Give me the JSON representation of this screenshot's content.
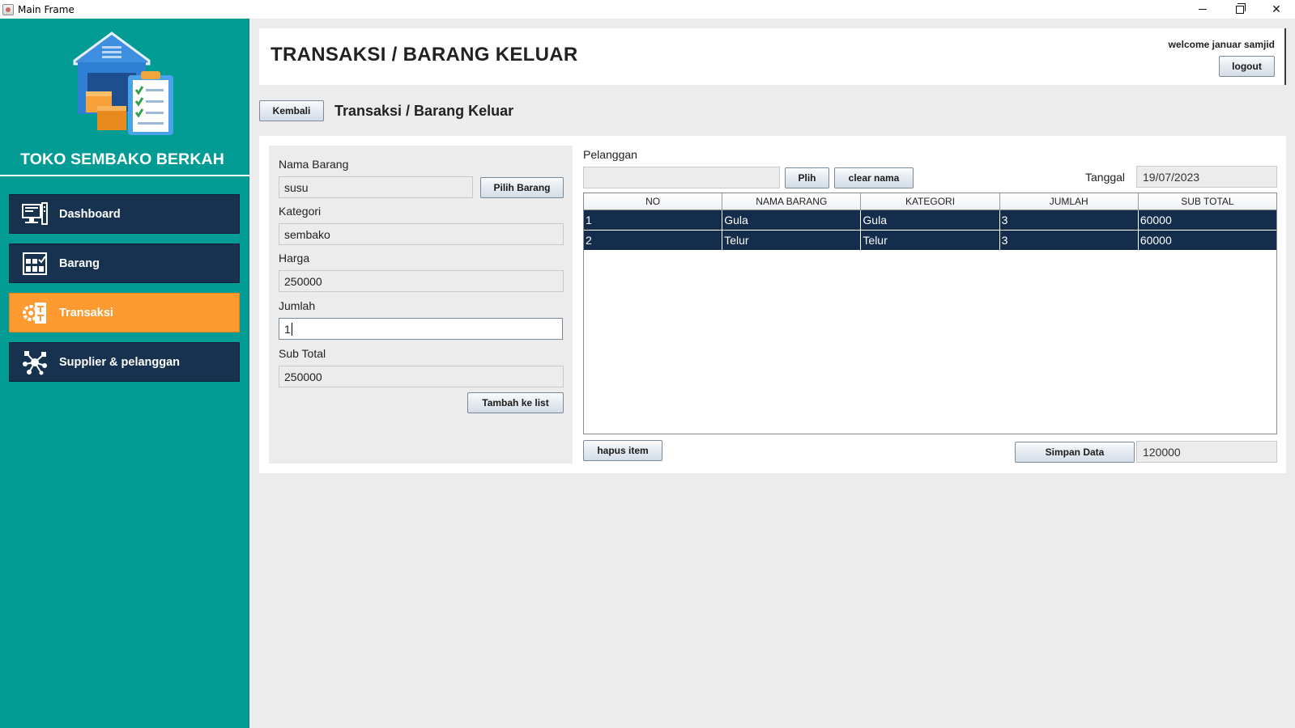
{
  "window": {
    "title": "Main Frame"
  },
  "sidebar": {
    "shop_name": "TOKO SEMBAKO BERKAH",
    "items": [
      {
        "label": "Dashboard",
        "icon": "monitor-icon"
      },
      {
        "label": "Barang",
        "icon": "warehouse-icon"
      },
      {
        "label": "Transaksi",
        "icon": "transaction-icon",
        "active": true
      },
      {
        "label": "Supplier & pelanggan",
        "icon": "network-icon"
      }
    ]
  },
  "header": {
    "title": "TRANSAKSI / BARANG KELUAR",
    "welcome": "welcome januar samjid",
    "logout_label": "logout"
  },
  "toolbar": {
    "back_label": "Kembali",
    "subtitle": "Transaksi / Barang Keluar"
  },
  "form": {
    "nama_barang_label": "Nama Barang",
    "nama_barang_value": "susu",
    "pilih_barang_label": "Pilih Barang",
    "kategori_label": "Kategori",
    "kategori_value": "sembako",
    "harga_label": "Harga",
    "harga_value": "250000",
    "jumlah_label": "Jumlah",
    "jumlah_value": "1",
    "subtotal_label": "Sub Total",
    "subtotal_value": "250000",
    "tambah_label": "Tambah ke list"
  },
  "customer": {
    "label": "Pelanggan",
    "value": "",
    "pick_label": "Plih",
    "clear_label": "clear nama",
    "date_label": "Tanggal",
    "date_value": "19/07/2023"
  },
  "table": {
    "columns": [
      "NO",
      "NAMA BARANG",
      "KATEGORI",
      "JUMLAH",
      "SUB TOTAL"
    ],
    "rows": [
      [
        "1",
        "Gula",
        "Gula",
        "3",
        "60000"
      ],
      [
        "2",
        "Telur",
        "Telur",
        "3",
        "60000"
      ]
    ]
  },
  "footer": {
    "delete_label": "hapus item",
    "save_label": "Simpan Data",
    "total_value": "120000"
  },
  "colors": {
    "sidebar_bg": "#039c95",
    "nav_bg": "#17324f",
    "nav_active": "#fd9b31",
    "row_bg": "#142d4c"
  }
}
